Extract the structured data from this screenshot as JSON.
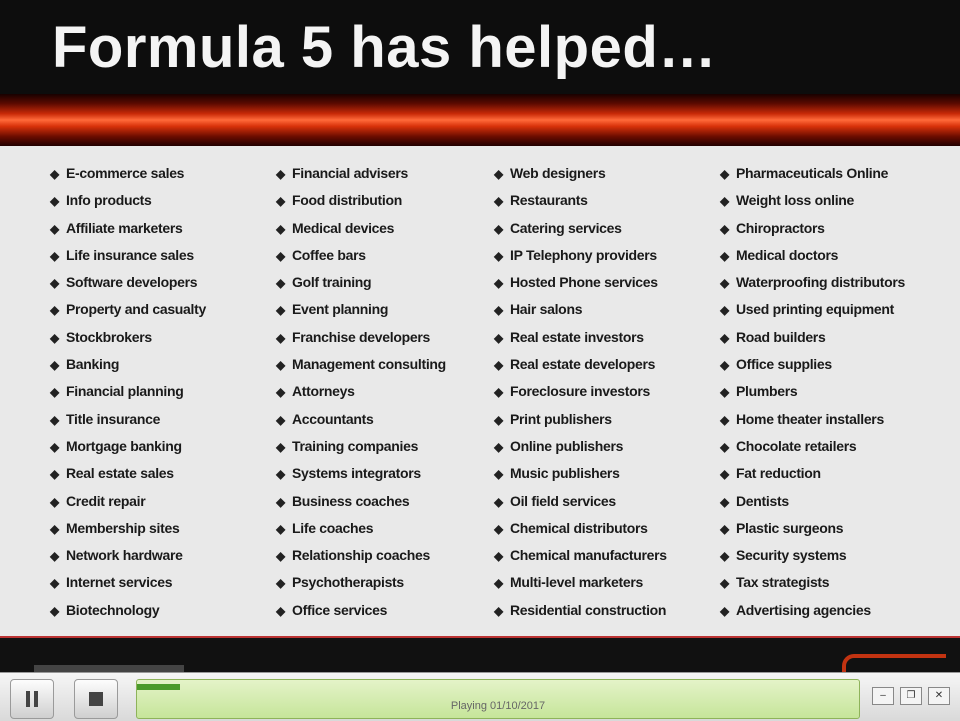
{
  "slide": {
    "title": "Formula 5 has helped…",
    "columns": [
      [
        "E-commerce sales",
        "Info products",
        "Affiliate marketers",
        "Life insurance sales",
        "Software developers",
        "Property and casualty",
        "Stockbrokers",
        "Banking",
        "Financial planning",
        "Title insurance",
        "Mortgage banking",
        "Real estate sales",
        "Credit repair",
        "Membership sites",
        "Network hardware",
        "Internet services",
        "Biotechnology"
      ],
      [
        "Financial advisers",
        "Food distribution",
        "Medical devices",
        "Coffee bars",
        "Golf training",
        "Event planning",
        "Franchise developers",
        "Management consulting",
        "Attorneys",
        "Accountants",
        "Training companies",
        "Systems integrators",
        "Business coaches",
        "Life coaches",
        "Relationship coaches",
        "Psychotherapists",
        "Office services"
      ],
      [
        "Web designers",
        "Restaurants",
        "Catering services",
        "IP Telephony providers",
        "Hosted Phone services",
        "Hair salons",
        "Real estate investors",
        "Real estate developers",
        "Foreclosure investors",
        "Print publishers",
        "Online publishers",
        "Music publishers",
        "Oil field services",
        "Chemical distributors",
        "Chemical manufacturers",
        "Multi-level marketers",
        "Residential construction"
      ],
      [
        "Pharmaceuticals Online",
        "Weight loss online",
        "Chiropractors",
        "Medical doctors",
        "Waterproofing distributors",
        "Used printing equipment",
        "Road builders",
        "Office supplies",
        "Plumbers",
        "Home theater installers",
        "Chocolate retailers",
        "Fat reduction",
        "Dentists",
        "Plastic surgeons",
        "Security systems",
        "Tax strategists",
        "Advertising agencies"
      ]
    ]
  },
  "player": {
    "status_text": "Playing 01/10/2017",
    "progress": 0.06
  },
  "colors": {
    "accent": "#d8320a",
    "progress": "#4a9a2a"
  },
  "icons": {
    "pause": "pause-icon",
    "stop": "stop-icon",
    "bullet": "bullet-icon"
  }
}
